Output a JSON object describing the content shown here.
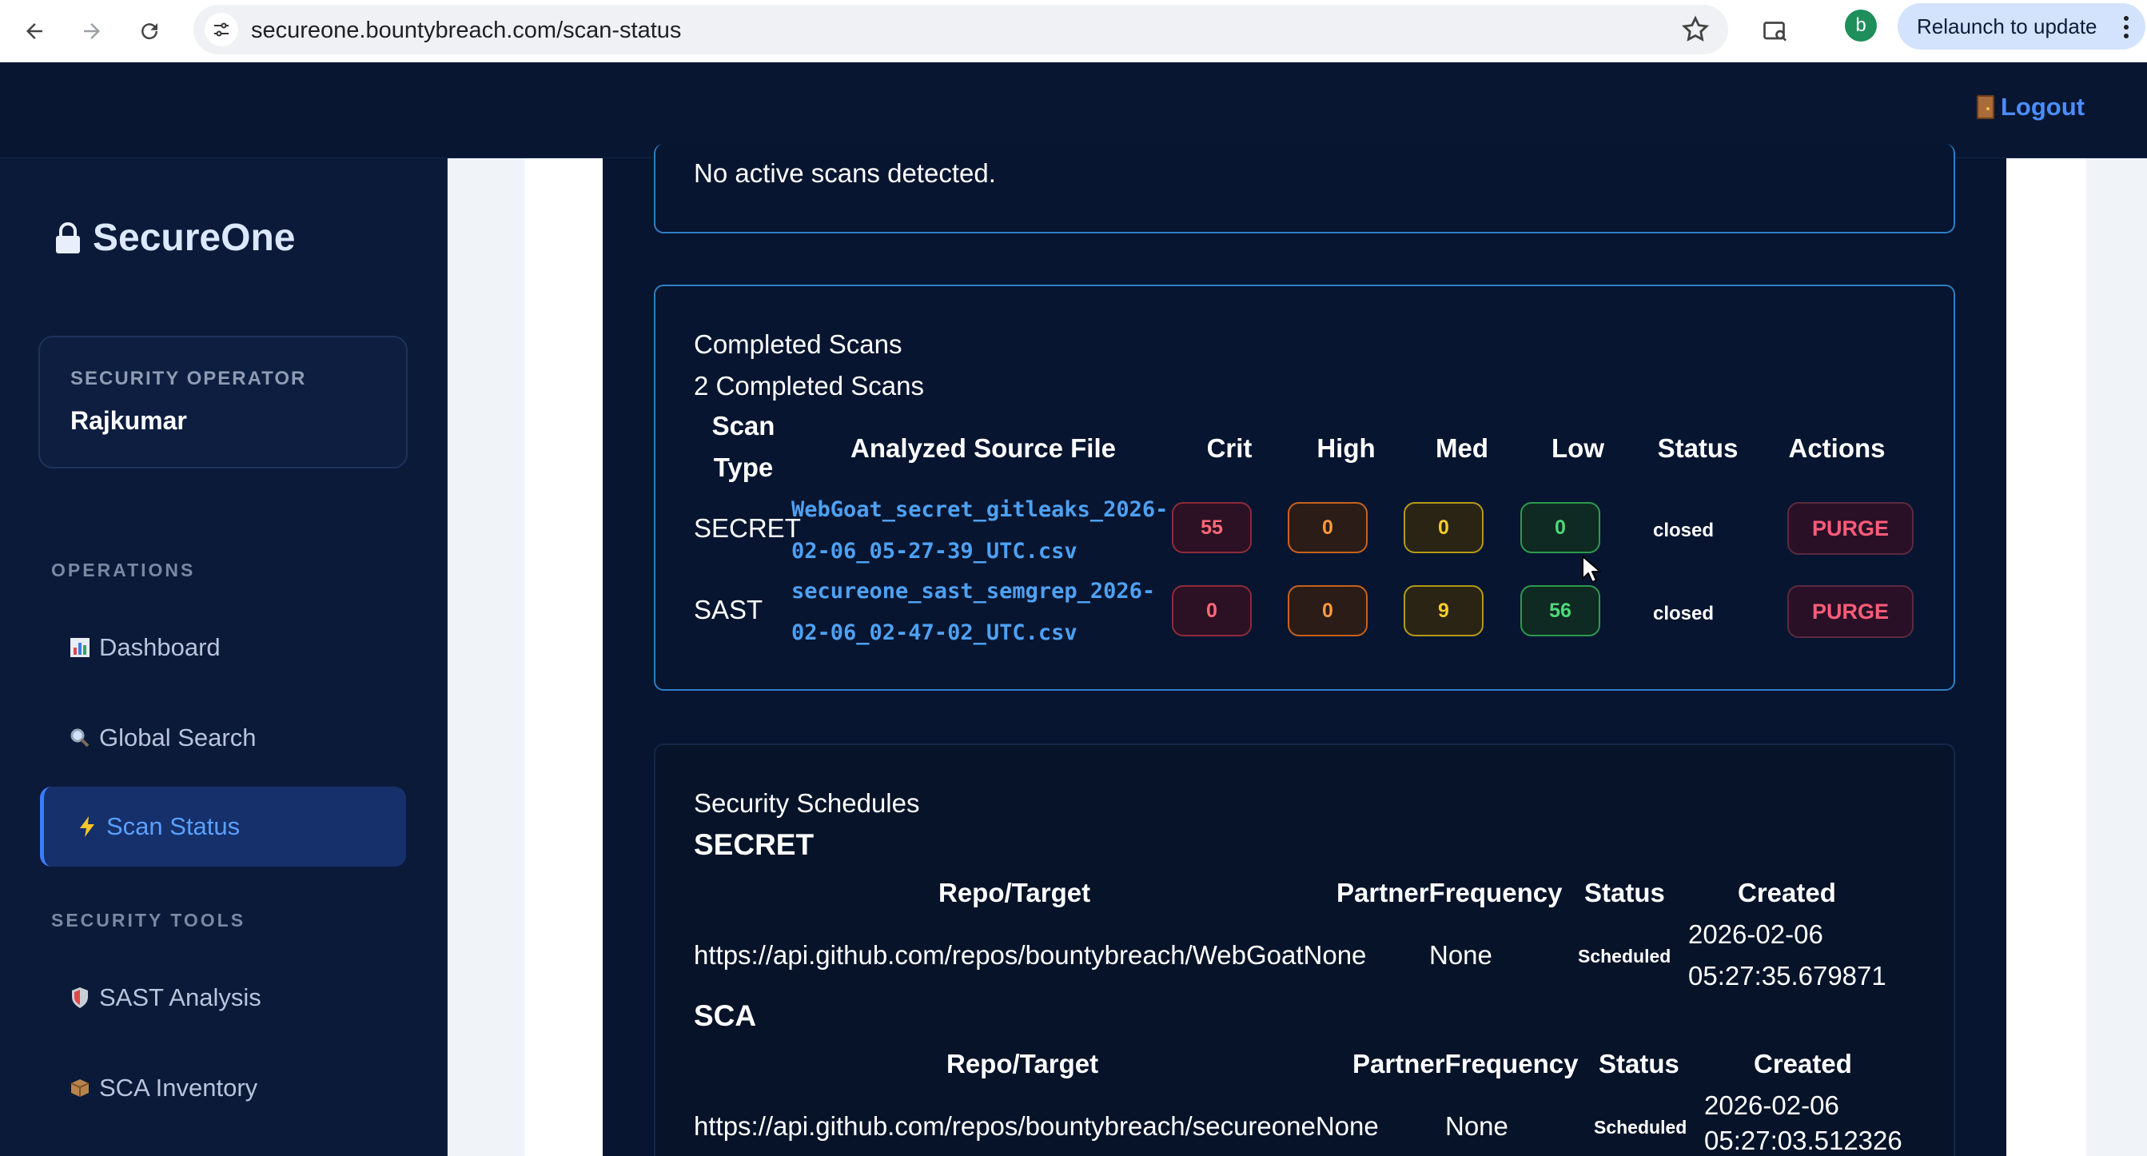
{
  "browser": {
    "url": "secureone.bountybreach.com/scan-status",
    "profile_initial": "b",
    "relaunch_label": "Relaunch to update"
  },
  "header": {
    "logout_label": "Logout"
  },
  "sidebar": {
    "brand": "SecureOne",
    "operator_role": "SECURITY OPERATOR",
    "operator_name": "Rajkumar",
    "sections": {
      "operations": "OPERATIONS",
      "security_tools": "SECURITY TOOLS"
    },
    "items": [
      {
        "label": "Dashboard",
        "icon": "bar-chart-icon"
      },
      {
        "label": "Global Search",
        "icon": "magnifier-icon"
      },
      {
        "label": "Scan Status",
        "icon": "lightning-icon",
        "active": true
      },
      {
        "label": "SAST Analysis",
        "icon": "shield-icon"
      },
      {
        "label": "SCA Inventory",
        "icon": "package-icon"
      }
    ]
  },
  "active_scans": {
    "message": "No active scans detected."
  },
  "completed": {
    "title": "Completed Scans",
    "count_label": "2 Completed Scans",
    "columns": {
      "scan_type_1": "Scan",
      "scan_type_2": "Type",
      "file": "Analyzed Source File",
      "crit": "Crit",
      "high": "High",
      "med": "Med",
      "low": "Low",
      "status": "Status",
      "actions": "Actions"
    },
    "rows": [
      {
        "type": "SECRET",
        "file_line1": "WebGoat_secret_gitleaks_2026-",
        "file_line2": "02-06_05-27-39_UTC.csv",
        "crit": "55",
        "high": "0",
        "med": "0",
        "low": "0",
        "status": "closed",
        "action": "PURGE"
      },
      {
        "type": "SAST",
        "file_line1": "secureone_sast_semgrep_2026-",
        "file_line2": "02-06_02-47-02_UTC.csv",
        "crit": "0",
        "high": "0",
        "med": "9",
        "low": "56",
        "status": "closed",
        "action": "PURGE"
      }
    ]
  },
  "schedules": {
    "title": "Security Schedules",
    "groups": [
      {
        "name": "SECRET",
        "columns": {
          "repo": "Repo/Target",
          "freq": "PartnerFrequency",
          "status": "Status",
          "created": "Created"
        },
        "row": {
          "repo": "https://api.github.com/repos/bountybreach/WebGoatNone",
          "freq": "None",
          "status": "Scheduled",
          "created_date": "2026-02-06",
          "created_time": "05:27:35.679871"
        }
      },
      {
        "name": "SCA",
        "columns": {
          "repo": "Repo/Target",
          "freq": "PartnerFrequency",
          "status": "Status",
          "created": "Created"
        },
        "row": {
          "repo": "https://api.github.com/repos/bountybreach/secureoneNone",
          "freq": "None",
          "status": "Scheduled",
          "created_date": "2026-02-06",
          "created_time": "05:27:03.512326"
        }
      }
    ]
  },
  "colors": {
    "accent": "#3d7bff",
    "crit": "#ff6a78",
    "high": "#ff9a3c",
    "med": "#f4cc2b",
    "low": "#4ed97a",
    "purge": "#ff5c79"
  }
}
